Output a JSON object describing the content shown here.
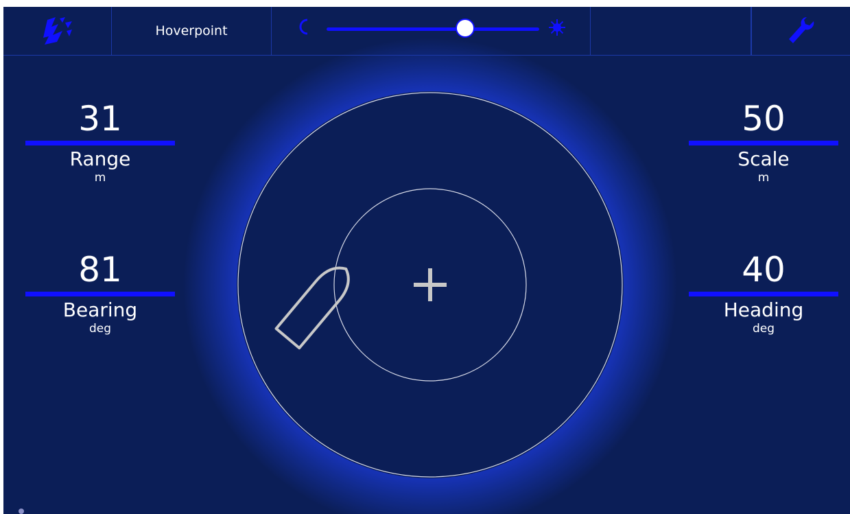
{
  "app": {
    "title": "Hoverpoint"
  },
  "topbar": {
    "logo_icon": "trident-logo-icon",
    "title": "Hoverpoint",
    "brightness_slider": {
      "left_icon": "moon-icon",
      "right_icon": "sun-icon",
      "value_fraction": 0.65
    },
    "settings_icon": "wrench-icon"
  },
  "readouts": {
    "range": {
      "value": "31",
      "label": "Range",
      "unit": "m"
    },
    "bearing": {
      "value": "81",
      "label": "Bearing",
      "unit": "deg"
    },
    "scale": {
      "value": "50",
      "label": "Scale",
      "unit": "m"
    },
    "heading": {
      "value": "40",
      "label": "Heading",
      "unit": "deg"
    }
  },
  "radar": {
    "center_icon": "crosshair-icon",
    "vessel_icon": "boat-icon"
  },
  "colors": {
    "background": "#0b1e57",
    "accent": "#1010ff",
    "ring": "#d8dbe8",
    "vessel": "#c8c8c8"
  }
}
